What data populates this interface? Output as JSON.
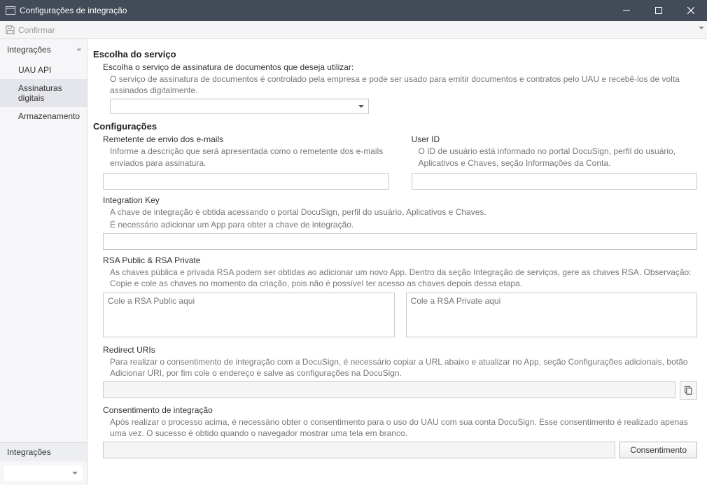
{
  "window": {
    "title": "Configurações de integração"
  },
  "toolbar": {
    "confirm_label": "Confirmar"
  },
  "sidebar": {
    "group_label": "Integrações",
    "items": [
      {
        "label": "UAU API"
      },
      {
        "label": "Assinaturas digitais"
      },
      {
        "label": "Armazenamento"
      }
    ],
    "footer_label": "Integrações"
  },
  "main": {
    "service": {
      "title": "Escolha do serviço",
      "prompt": "Escolha o serviço de assinatura de documentos que deseja utilizar:",
      "help": "O serviço de assinatura de documentos é controlado pela empresa e pode ser usado para emitir documentos e contratos pelo UAU e recebê-los de volta assinados digitalmente.",
      "selected": ""
    },
    "config": {
      "title": "Configurações",
      "sender": {
        "label": "Remetente de envio dos e-mails",
        "help": "Informe a descrição que será apresentada como o remetente dos e-mails enviados para assinatura.",
        "value": ""
      },
      "userid": {
        "label": "User ID",
        "help": "O ID de usuário está informado no portal DocuSign, perfil do usuário, Aplicativos e Chaves, seção Informações da Conta.",
        "value": ""
      },
      "integration_key": {
        "label": "Integration Key",
        "help1": "A chave de integração é obtida acessando o portal DocuSign, perfil do usuário, Aplicativos e Chaves.",
        "help2": "É necessário adicionar um App para obter a chave de integração.",
        "value": ""
      },
      "rsa": {
        "label": "RSA Public & RSA Private",
        "help": "As chaves pública e privada RSA podem ser obtidas ao adicionar um novo App. Dentro da seção Integração de serviços, gere as chaves RSA. Observação: Copie e cole as chaves no momento da criação, pois não é possível ter acesso as chaves depois dessa etapa.",
        "public_placeholder": "Cole a RSA Public aqui",
        "private_placeholder": "Cole a RSA Private aqui",
        "public_value": "",
        "private_value": ""
      },
      "redirect": {
        "label": "Redirect URIs",
        "help": "Para realizar o consentimento de integração com a DocuSign, é necessário copiar a URL abaixo e atualizar no App, seção Configurações adicionais, botão Adicionar URI, por fim cole o endereço e salve as configurações na DocuSign.",
        "value": ""
      },
      "consent": {
        "label": "Consentimento de integração",
        "help": "Após realizar o processo acima, é necessário obter o consentimento para o uso do UAU com sua conta DocuSign. Esse consentimento é realizado apenas uma vez. O sucesso é obtido quando o navegador mostrar uma tela em branco.",
        "value": "",
        "button_label": "Consentimento"
      }
    }
  }
}
